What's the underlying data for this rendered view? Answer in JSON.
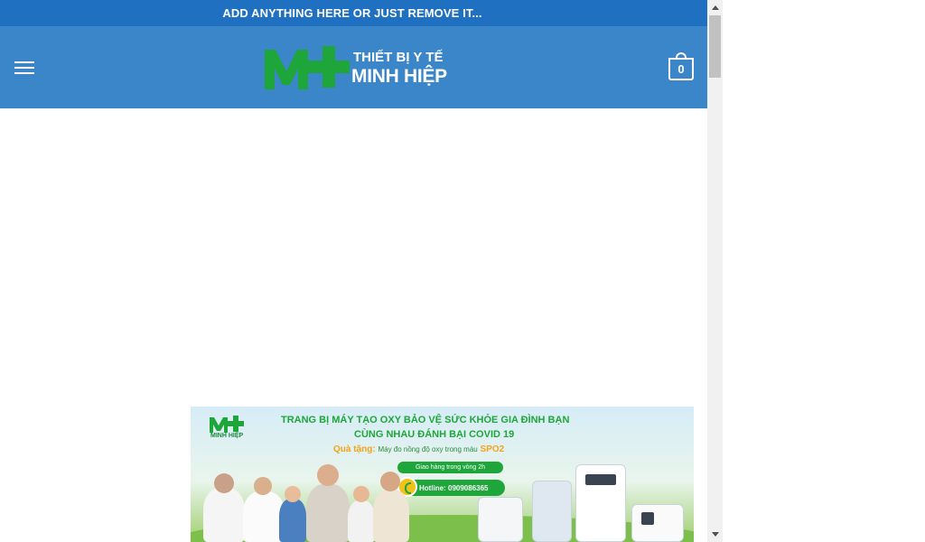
{
  "topbar": {
    "text": "ADD ANYTHING HERE OR JUST REMOVE IT..."
  },
  "header": {
    "logo_line1": "THIẾT BỊ Y TẾ",
    "logo_line2": "MINH HIỆP",
    "cart_count": "0"
  },
  "banner": {
    "brand": "MINH HIỆP",
    "title_line1": "TRANG BỊ MÁY TẠO OXY BẢO VỆ SỨC KHỎE GIA ĐÌNH BẠN",
    "title_line2": "CÙNG NHAU ĐÁNH BẠI COVID 19",
    "gift_label": "Quà tặng:",
    "gift_text": "Máy đo nồng độ oxy trong máu",
    "gift_item": "SPO2",
    "delivery": "Giao hàng trong vòng 2h",
    "hotline": "Hotline: 0909086365"
  },
  "colors": {
    "topbar_bg": "#1f70c1",
    "header_bg": "#3a86c8",
    "logo_green": "#1fa63a"
  },
  "icons": [
    "hamburger-menu-icon",
    "cart-icon",
    "phone-icon",
    "scroll-up-arrow",
    "scroll-down-arrow"
  ]
}
